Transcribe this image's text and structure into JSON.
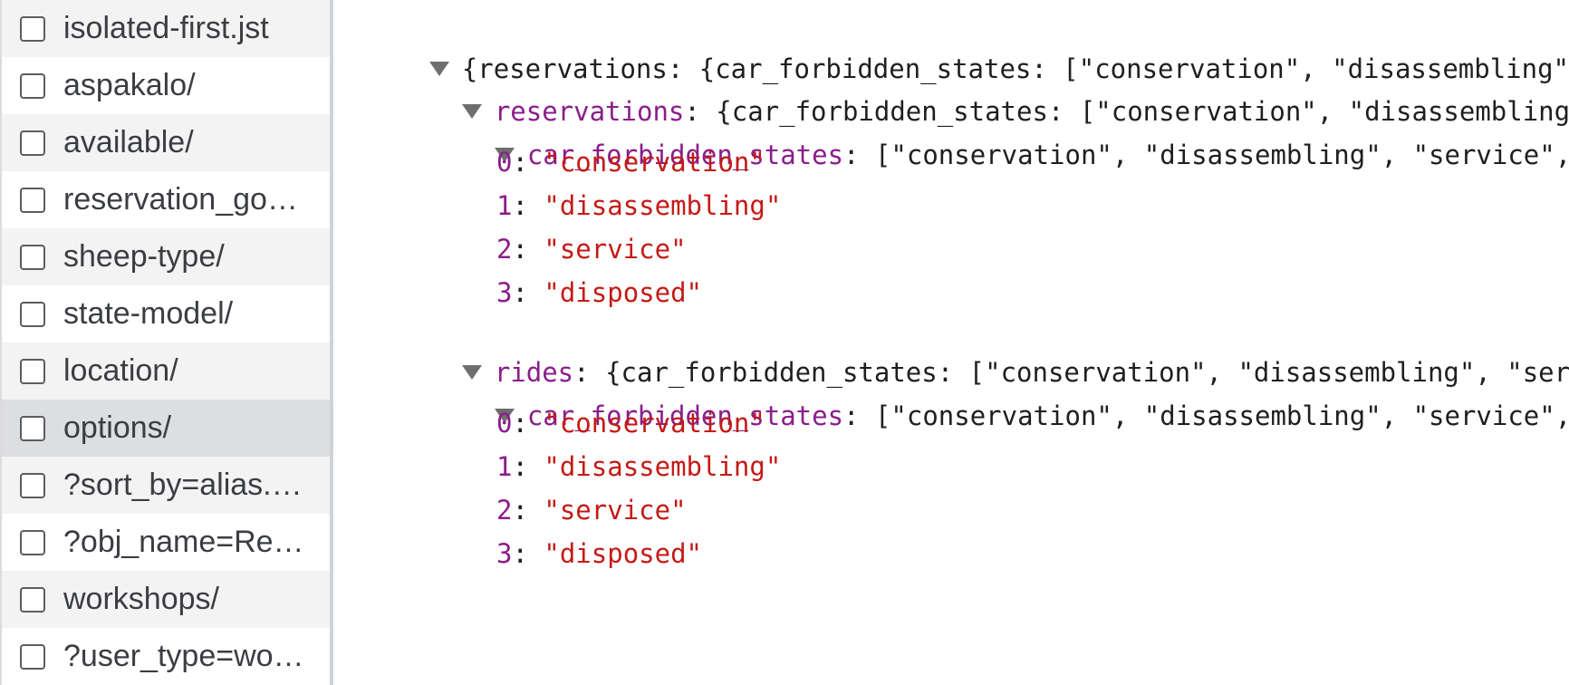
{
  "sidebar": {
    "items": [
      {
        "label": "isolated-first.jst",
        "checked": false
      },
      {
        "label": "aspakalo/",
        "checked": false
      },
      {
        "label": "available/",
        "checked": false
      },
      {
        "label": "reservation_go…",
        "checked": false
      },
      {
        "label": "sheep-type/",
        "checked": false
      },
      {
        "label": "state-model/",
        "checked": false
      },
      {
        "label": "location/",
        "checked": false
      },
      {
        "label": "options/",
        "checked": false,
        "selected": true
      },
      {
        "label": "?sort_by=alias.…",
        "checked": false
      },
      {
        "label": "?obj_name=Re…",
        "checked": false
      },
      {
        "label": "workshops/",
        "checked": false
      },
      {
        "label": "?user_type=wo…",
        "checked": false
      }
    ]
  },
  "preview": {
    "root_summary": "{reservations: {car_forbidden_states: [\"conservation\", \"disassembling\", \"service\", \"disposed\"]}, rides: {...}}",
    "reservations_key": "reservations",
    "reservations_summary": "{car_forbidden_states: [\"conservation\", \"disassembling\", \"service\", \"disposed\"]}",
    "rides_key": "rides",
    "rides_summary": "{car_forbidden_states: [\"conservation\", \"disassembling\", \"service\", \"disposed\"]}",
    "array_key": "car_forbidden_states",
    "array_summary": "[\"conservation\", \"disassembling\", \"service\", \"disposed\"]",
    "reservations_states": [
      {
        "index": "0",
        "value": "\"conservation\""
      },
      {
        "index": "1",
        "value": "\"disassembling\""
      },
      {
        "index": "2",
        "value": "\"service\""
      },
      {
        "index": "3",
        "value": "\"disposed\""
      }
    ],
    "rides_states": [
      {
        "index": "0",
        "value": "\"conservation\""
      },
      {
        "index": "1",
        "value": "\"disassembling\""
      },
      {
        "index": "2",
        "value": "\"service\""
      },
      {
        "index": "3",
        "value": "\"disposed\""
      }
    ]
  }
}
